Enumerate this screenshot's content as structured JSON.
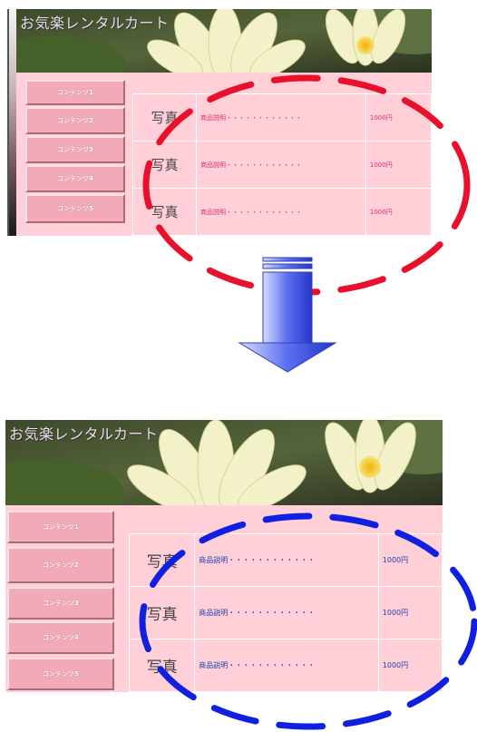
{
  "top_screen": {
    "title": "お気楽レンタルカート",
    "nav": [
      "コンテンツ1",
      "コンテンツ2",
      "コンテンツ3",
      "コンテンツ4",
      "コンテンツ5"
    ],
    "products": [
      {
        "photo": "写真",
        "description": "商品説明・・・・・・・・・・・・",
        "price": "1000円"
      },
      {
        "photo": "写真",
        "description": "商品説明・・・・・・・・・・・・",
        "price": "1000円"
      },
      {
        "photo": "写真",
        "description": "商品説明・・・・・・・・・・・・",
        "price": "1000円"
      }
    ],
    "highlight_color": "#e8102a"
  },
  "bottom_screen": {
    "title": "お気楽レンタルカート",
    "nav": [
      "コンテンツ1",
      "コンテンツ2",
      "コンテンツ3",
      "コンテンツ4",
      "コンテンツ5"
    ],
    "products": [
      {
        "photo": "写真",
        "description": "商品説明・・・・・・・・・・・・",
        "price": "1000円"
      },
      {
        "photo": "写真",
        "description": "商品説明・・・・・・・・・・・・",
        "price": "1000円"
      },
      {
        "photo": "写真",
        "description": "商品説明・・・・・・・・・・・・",
        "price": "1000円"
      }
    ],
    "highlight_color": "#1020e0"
  },
  "arrow": {
    "icon": "arrow-down-icon",
    "color": "#5a6ff0"
  }
}
